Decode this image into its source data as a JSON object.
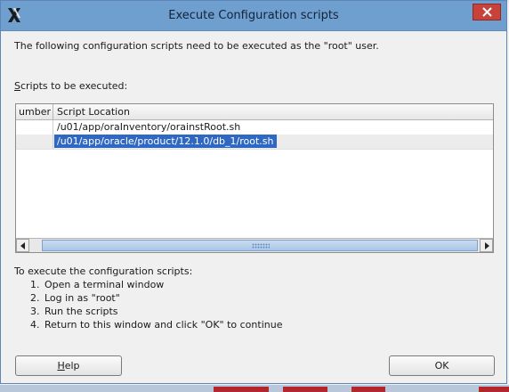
{
  "window": {
    "title": "Execute Configuration scripts"
  },
  "intro_text": "The following configuration scripts need to be executed as the \"root\" user.",
  "scripts_label": {
    "mnemonic": "S",
    "rest": "cripts to be executed:"
  },
  "table": {
    "columns": [
      "umber",
      "Script Location"
    ],
    "rows": [
      {
        "number": "",
        "location": "/u01/app/oraInventory/orainstRoot.sh"
      },
      {
        "number": "",
        "location": "/u01/app/oracle/product/12.1.0/db_1/root.sh"
      }
    ],
    "selected_index": 1
  },
  "instructions": {
    "heading": "To execute the configuration scripts:",
    "steps": [
      "Open a terminal window",
      "Log in as \"root\"",
      "Run the scripts",
      "Return to this window and click \"OK\" to continue"
    ]
  },
  "buttons": {
    "help_mnemonic": "H",
    "help_rest": "elp",
    "ok": "OK"
  },
  "colors": {
    "titlebar": "#6f9fcf",
    "close": "#c7433a",
    "selection": "#2f68c3"
  }
}
